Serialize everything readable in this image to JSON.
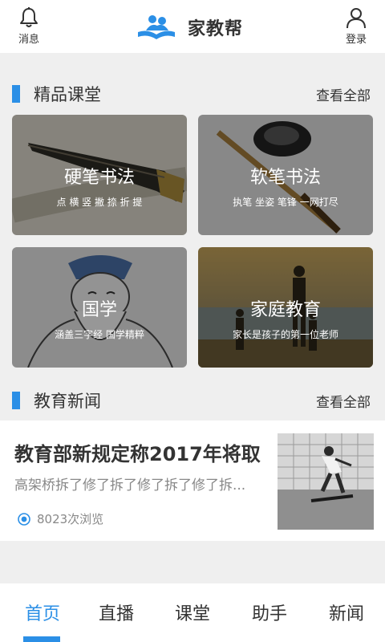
{
  "header": {
    "left_label": "消息",
    "right_label": "登录",
    "app_title": "家教帮",
    "left_icon": "bell-icon",
    "right_icon": "user-icon"
  },
  "featured": {
    "section_title": "精品课堂",
    "more_label": "查看全部",
    "cards": [
      {
        "title": "硬笔书法",
        "subtitle": "点 横 竖 撇 捺 折 提"
      },
      {
        "title": "软笔书法",
        "subtitle": "执笔 坐姿 笔锋 一网打尽"
      },
      {
        "title": "国学",
        "subtitle": "涵盖三字经 国学精粹"
      },
      {
        "title": "家庭教育",
        "subtitle": "家长是孩子的第一位老师"
      }
    ]
  },
  "news_section": {
    "section_title": "教育新闻",
    "more_label": "查看全部",
    "items": [
      {
        "title": "教育部新规定称2017年将取",
        "summary": "高架桥拆了修了拆了修了拆了修了拆...",
        "views": "8023次浏览"
      }
    ]
  },
  "bottom_nav": {
    "items": [
      "首页",
      "直播",
      "课堂",
      "助手",
      "新闻"
    ],
    "active_index": 0
  },
  "colors": {
    "accent": "#2b8fe6",
    "background": "#efefef"
  }
}
